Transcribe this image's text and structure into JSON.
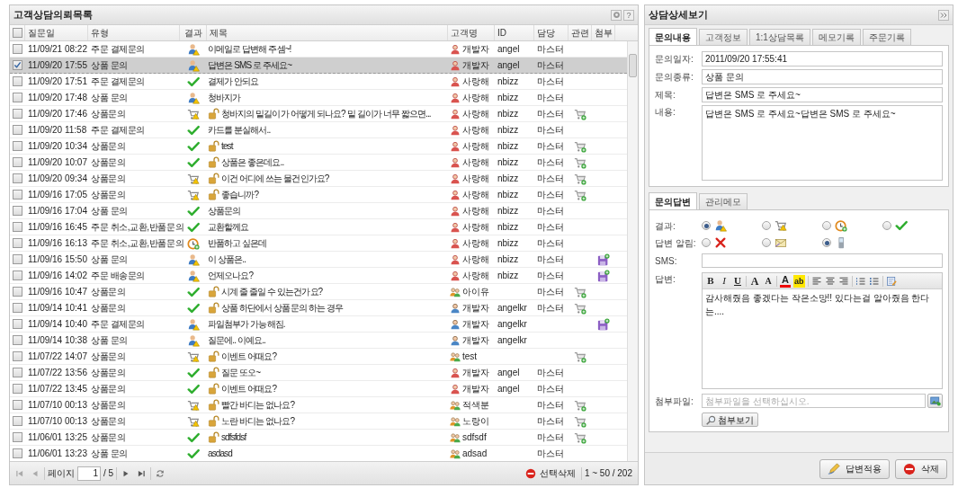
{
  "list": {
    "title": "고객상담의뢰목록",
    "help": "?",
    "header_checked": false,
    "columns": [
      "질문일",
      "유형",
      "결과",
      "제목",
      "고객명",
      "ID",
      "담당",
      "관련",
      "첨부"
    ],
    "rows": [
      {
        "checked": false,
        "selected": false,
        "date": "11/09/21 08:22",
        "type": "주문 결제문의",
        "result": {
          "kind": "waiting"
        },
        "locked": false,
        "subject": "이메일로 답변해 주셈~!",
        "customer": {
          "kind": "female",
          "name": "개발자"
        },
        "id": "angel",
        "owner": "마스터",
        "related": false,
        "attached": false
      },
      {
        "checked": true,
        "selected": true,
        "date": "11/09/20 17:55",
        "type": "상품 문의",
        "result": {
          "kind": "waiting"
        },
        "locked": false,
        "subject": "답변은 SMS 로 주세요~",
        "customer": {
          "kind": "female",
          "name": "개발자"
        },
        "id": "angel",
        "owner": "마스터",
        "related": false,
        "attached": false
      },
      {
        "checked": false,
        "selected": false,
        "date": "11/09/20 17:51",
        "type": "주문 결제문의",
        "result": {
          "kind": "done"
        },
        "locked": false,
        "subject": "결제가 안되요",
        "customer": {
          "kind": "female",
          "name": "사랑해"
        },
        "id": "nbizz",
        "owner": "마스터",
        "related": false,
        "attached": false
      },
      {
        "checked": false,
        "selected": false,
        "date": "11/09/20 17:48",
        "type": "상품 문의",
        "result": {
          "kind": "waiting"
        },
        "locked": false,
        "subject": "청바지가",
        "customer": {
          "kind": "female",
          "name": "사랑해"
        },
        "id": "nbizz",
        "owner": "마스터",
        "related": false,
        "attached": false
      },
      {
        "checked": false,
        "selected": false,
        "date": "11/09/20 17:46",
        "type": "상품문의",
        "result": {
          "kind": "order"
        },
        "locked": true,
        "subject": "청바지의 밑길이가 어떻게 되나요? 밑 길이가 너무 짧으면...",
        "customer": {
          "kind": "female",
          "name": "사랑해"
        },
        "id": "nbizz",
        "owner": "마스터",
        "related": true,
        "attached": false
      },
      {
        "checked": false,
        "selected": false,
        "date": "11/09/20 11:58",
        "type": "주문 결제문의",
        "result": {
          "kind": "done"
        },
        "locked": false,
        "subject": "카드를 분실해서..",
        "customer": {
          "kind": "female",
          "name": "사랑해"
        },
        "id": "nbizz",
        "owner": "마스터",
        "related": false,
        "attached": false
      },
      {
        "checked": false,
        "selected": false,
        "date": "11/09/20 10:34",
        "type": "상품문의",
        "result": {
          "kind": "done"
        },
        "locked": true,
        "subject": "test",
        "customer": {
          "kind": "female",
          "name": "사랑해"
        },
        "id": "nbizz",
        "owner": "마스터",
        "related": true,
        "attached": false
      },
      {
        "checked": false,
        "selected": false,
        "date": "11/09/20 10:07",
        "type": "상품문의",
        "result": {
          "kind": "done"
        },
        "locked": true,
        "subject": "상품은 좋은데요..",
        "customer": {
          "kind": "female",
          "name": "사랑해"
        },
        "id": "nbizz",
        "owner": "마스터",
        "related": true,
        "attached": false
      },
      {
        "checked": false,
        "selected": false,
        "date": "11/09/20 09:34",
        "type": "상품문의",
        "result": {
          "kind": "order"
        },
        "locked": true,
        "subject": "이건 어디에 쓰는 물건인가요?",
        "customer": {
          "kind": "female",
          "name": "사랑해"
        },
        "id": "nbizz",
        "owner": "마스터",
        "related": true,
        "attached": false
      },
      {
        "checked": false,
        "selected": false,
        "date": "11/09/16 17:05",
        "type": "상품문의",
        "result": {
          "kind": "order"
        },
        "locked": true,
        "subject": "좋습니까?",
        "customer": {
          "kind": "female",
          "name": "사랑해"
        },
        "id": "nbizz",
        "owner": "마스터",
        "related": true,
        "attached": false
      },
      {
        "checked": false,
        "selected": false,
        "date": "11/09/16 17:04",
        "type": "상품 문의",
        "result": {
          "kind": "done"
        },
        "locked": false,
        "subject": "상품문의",
        "customer": {
          "kind": "female",
          "name": "사랑해"
        },
        "id": "nbizz",
        "owner": "마스터",
        "related": false,
        "attached": false
      },
      {
        "checked": false,
        "selected": false,
        "date": "11/09/16 16:45",
        "type": "주문 취소,교환,반품문의",
        "result": {
          "kind": "done"
        },
        "locked": false,
        "subject": "교환할께요",
        "customer": {
          "kind": "female",
          "name": "사랑해"
        },
        "id": "nbizz",
        "owner": "마스터",
        "related": false,
        "attached": false
      },
      {
        "checked": false,
        "selected": false,
        "date": "11/09/16 16:13",
        "type": "주문 취소,교환,반품문의",
        "result": {
          "kind": "pending"
        },
        "locked": false,
        "subject": "반품하고 싶은데",
        "customer": {
          "kind": "female",
          "name": "사랑해"
        },
        "id": "nbizz",
        "owner": "마스터",
        "related": false,
        "attached": false
      },
      {
        "checked": false,
        "selected": false,
        "date": "11/09/16 15:50",
        "type": "상품 문의",
        "result": {
          "kind": "waiting"
        },
        "locked": false,
        "subject": "이 상품은..",
        "customer": {
          "kind": "female",
          "name": "사랑해"
        },
        "id": "nbizz",
        "owner": "마스터",
        "related": false,
        "attached": true
      },
      {
        "checked": false,
        "selected": false,
        "date": "11/09/16 14:02",
        "type": "주문 배송문의",
        "result": {
          "kind": "waiting"
        },
        "locked": false,
        "subject": "언제오나요?",
        "customer": {
          "kind": "female",
          "name": "사랑해"
        },
        "id": "nbizz",
        "owner": "마스터",
        "related": false,
        "attached": true
      },
      {
        "checked": false,
        "selected": false,
        "date": "11/09/16 10:47",
        "type": "상품문의",
        "result": {
          "kind": "done"
        },
        "locked": true,
        "subject": "시계 줄 줄일 수 있는건가요?",
        "customer": {
          "kind": "guest",
          "name": "아이유"
        },
        "owner": "마스터",
        "related": true,
        "attached": false
      },
      {
        "checked": false,
        "selected": false,
        "date": "11/09/14 10:41",
        "type": "상품문의",
        "result": {
          "kind": "done"
        },
        "locked": true,
        "subject": "상품 하단에서 상품문의 하는 경우",
        "customer": {
          "kind": "male",
          "name": "개발자"
        },
        "id": "angelkr",
        "owner": "마스터",
        "related": true,
        "attached": false
      },
      {
        "checked": false,
        "selected": false,
        "date": "11/09/14 10:40",
        "type": "주문 결제문의",
        "result": {
          "kind": "waiting"
        },
        "locked": false,
        "subject": "파일첨부가 가능해짐.",
        "customer": {
          "kind": "male",
          "name": "개발자"
        },
        "id": "angelkr",
        "related": false,
        "attached": true
      },
      {
        "checked": false,
        "selected": false,
        "date": "11/09/14 10:38",
        "type": "상품 문의",
        "result": {
          "kind": "waiting"
        },
        "locked": false,
        "subject": "질문에.. 이예요..",
        "customer": {
          "kind": "male",
          "name": "개발자"
        },
        "id": "angelkr",
        "related": false,
        "attached": false
      },
      {
        "checked": false,
        "selected": false,
        "date": "11/07/22 14:07",
        "type": "상품문의",
        "result": {
          "kind": "order"
        },
        "locked": true,
        "subject": "이벤트 어때요?",
        "customer": {
          "kind": "guest",
          "name": "test"
        },
        "related": true,
        "attached": false
      },
      {
        "checked": false,
        "selected": false,
        "date": "11/07/22 13:56",
        "type": "상품문의",
        "result": {
          "kind": "done"
        },
        "locked": true,
        "subject": "질문 또오~",
        "customer": {
          "kind": "female",
          "name": "개발자"
        },
        "id": "angel",
        "owner": "마스터",
        "related": false,
        "attached": false
      },
      {
        "checked": false,
        "selected": false,
        "date": "11/07/22 13:45",
        "type": "상품문의",
        "result": {
          "kind": "done"
        },
        "locked": true,
        "subject": "이벤트 어때요?",
        "customer": {
          "kind": "female",
          "name": "개발자"
        },
        "id": "angel",
        "owner": "마스터",
        "related": false,
        "attached": false
      },
      {
        "checked": false,
        "selected": false,
        "date": "11/07/10 00:13",
        "type": "상품문의",
        "result": {
          "kind": "order"
        },
        "locked": true,
        "subject": "빨간 바디는 없나요?",
        "customer": {
          "kind": "guest",
          "name": "적색분"
        },
        "owner": "마스터",
        "related": true,
        "attached": false
      },
      {
        "checked": false,
        "selected": false,
        "date": "11/07/10 00:13",
        "type": "상품문의",
        "result": {
          "kind": "order"
        },
        "locked": true,
        "subject": "노란 바디는 없나요?",
        "customer": {
          "kind": "guest",
          "name": "노랑이"
        },
        "owner": "마스터",
        "related": true,
        "attached": false
      },
      {
        "checked": false,
        "selected": false,
        "date": "11/06/01 13:25",
        "type": "상품문의",
        "result": {
          "kind": "done"
        },
        "locked": true,
        "subject": "sdfsfdsf",
        "customer": {
          "kind": "guest",
          "name": "sdfsdf"
        },
        "owner": "마스터",
        "related": true,
        "attached": false
      },
      {
        "checked": false,
        "selected": false,
        "date": "11/06/01 13:23",
        "type": "상품 문의",
        "result": {
          "kind": "done"
        },
        "locked": false,
        "subject": "asdasd",
        "customer": {
          "kind": "guest",
          "name": "adsad"
        },
        "owner": "마스터",
        "related": false,
        "attached": false
      }
    ],
    "pager": {
      "page_label": "페이지",
      "page": "1",
      "total_pages": "/ 5",
      "delete_label": "선택삭제",
      "range": "1 ~ 50 / 202"
    }
  },
  "detail": {
    "title": "상담상세보기",
    "tabs": [
      {
        "label": "문의내용",
        "selected": true
      },
      {
        "label": "고객정보",
        "selected": false
      },
      {
        "label": "1:1상담목록",
        "selected": false
      },
      {
        "label": "메모기록",
        "selected": false
      },
      {
        "label": "주문기록",
        "selected": false
      }
    ],
    "fields": [
      {
        "label": "문의일자:",
        "value": "2011/09/20 17:55:41"
      },
      {
        "label": "문의종류:",
        "value": "상품 문의"
      },
      {
        "label": "제목:",
        "value": "답변은 SMS 로 주세요~"
      }
    ],
    "content": {
      "label": "내용:",
      "value": "답변은 SMS 로 주세요~답변은 SMS 로 주세요~"
    },
    "answer_tabs": [
      {
        "label": "문의답변",
        "selected": true
      },
      {
        "label": "관리메모",
        "selected": false
      }
    ],
    "result": {
      "label": "결과:",
      "options": [
        {
          "kind": "waiting",
          "selected": true
        },
        {
          "kind": "order",
          "selected": false
        },
        {
          "kind": "pending",
          "selected": false
        },
        {
          "kind": "done",
          "selected": false
        }
      ]
    },
    "notify": {
      "label": "답변 알림:",
      "options": [
        {
          "kind": "none",
          "selected": false
        },
        {
          "kind": "email",
          "selected": false
        },
        {
          "kind": "phone",
          "selected": true
        }
      ]
    },
    "sms": {
      "label": "SMS:"
    },
    "answer": {
      "label": "답변:",
      "text": "감사해줬음 좋겠다는 작은소망!! 있다는걸 알아줬음 한다는....",
      "toolbar": [
        {
          "kind": "bold",
          "label": "B"
        },
        {
          "kind": "italic",
          "label": "I"
        },
        {
          "kind": "underline",
          "label": "U"
        },
        {
          "kind": "grow",
          "label": "A"
        },
        {
          "kind": "shrink",
          "label": "A"
        },
        {
          "kind": "font_color",
          "label": "A"
        },
        {
          "kind": "highlight",
          "label": "ab"
        },
        {
          "kind": "align_left"
        },
        {
          "kind": "align_center"
        },
        {
          "kind": "align_right"
        },
        {
          "kind": "ordered_list"
        },
        {
          "kind": "bullet_list"
        },
        {
          "kind": "source"
        }
      ]
    },
    "attachment": {
      "label": "첨부파일:",
      "placeholder": "첨부파일을 선택하십시오.",
      "view": "첨부보기"
    },
    "buttons": [
      {
        "kind": "apply",
        "label": "답변적용"
      },
      {
        "kind": "delete",
        "label": "삭제"
      }
    ]
  }
}
